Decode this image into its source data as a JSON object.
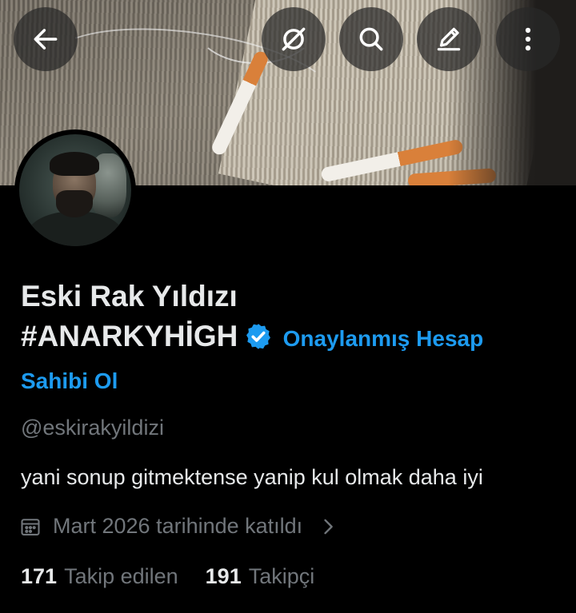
{
  "top_bar": {
    "back_icon": "arrow-left-icon",
    "grok_icon": "grok-icon",
    "search_icon": "search-icon",
    "edit_icon": "edit-pencil-icon",
    "more_icon": "more-vertical-icon"
  },
  "profile": {
    "display_name_line1": "Eski Rak Yıldızı",
    "display_name_line2": "#ANARKYHİGH",
    "verified_cta": "Onaylanmış Hesap",
    "verified_cta_line2": "Sahibi Ol",
    "handle": "@eskirakyildizi",
    "bio": "yani sonup gitmektense yanip kul olmak daha iyi",
    "joined": "Mart 2026 tarihinde katıldı",
    "following_count": "171",
    "following_label": "Takip edilen",
    "followers_count": "191",
    "followers_label": "Takipçi"
  },
  "colors": {
    "background": "#000000",
    "primary_text": "#e7e9ea",
    "secondary_text": "#71767b",
    "accent": "#1d9bf0"
  }
}
